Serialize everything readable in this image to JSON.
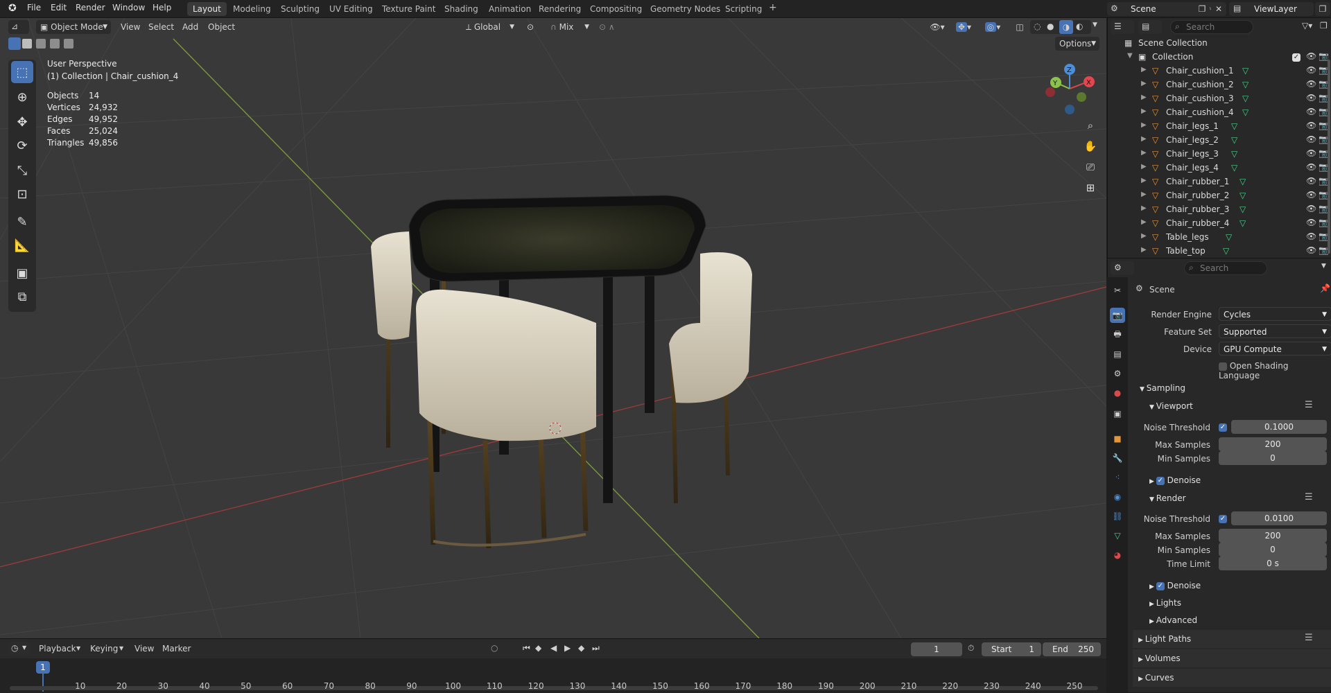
{
  "app_menu": [
    "File",
    "Edit",
    "Render",
    "Window",
    "Help"
  ],
  "workspaces": [
    "Layout",
    "Modeling",
    "Sculpting",
    "UV Editing",
    "Texture Paint",
    "Shading",
    "Animation",
    "Rendering",
    "Compositing",
    "Geometry Nodes",
    "Scripting"
  ],
  "active_workspace": "Layout",
  "add_workspace_icon": "plus-icon",
  "scene_name": "Scene",
  "view_layer": "ViewLayer",
  "viewport_header": {
    "mode": "Object Mode",
    "menus": [
      "View",
      "Select",
      "Add",
      "Object"
    ],
    "transform_orientation": "Global",
    "snap_mode": "Mix",
    "options_label": "Options"
  },
  "overlay_text": {
    "view_name": "User Perspective",
    "collection_object": "(1) Collection | Chair_cushion_4",
    "stats": [
      {
        "label": "Objects",
        "value": "14"
      },
      {
        "label": "Vertices",
        "value": "24,932"
      },
      {
        "label": "Edges",
        "value": "49,952"
      },
      {
        "label": "Faces",
        "value": "25,024"
      },
      {
        "label": "Triangles",
        "value": "49,856"
      }
    ]
  },
  "gizmo_axes": [
    "X",
    "Y",
    "Z"
  ],
  "tools": [
    "select-box-icon",
    "cursor-icon",
    "move-icon",
    "rotate-icon",
    "scale-icon",
    "transform-icon",
    "annotate-icon",
    "measure-icon",
    "add-cube-icon",
    "extrude-icon"
  ],
  "timeline": {
    "menus": [
      "Playback",
      "Keying",
      "View",
      "Marker"
    ],
    "current_frame": "1",
    "start_label": "Start",
    "start": "1",
    "end_label": "End",
    "end": "250",
    "ticks": [
      "1",
      "10",
      "20",
      "30",
      "40",
      "50",
      "60",
      "70",
      "80",
      "90",
      "100",
      "110",
      "120",
      "130",
      "140",
      "150",
      "160",
      "170",
      "180",
      "190",
      "200",
      "210",
      "220",
      "230",
      "240",
      "250"
    ]
  },
  "outliner": {
    "search_placeholder": "Search",
    "root": "Scene Collection",
    "collection": "Collection",
    "items": [
      "Chair_cushion_1",
      "Chair_cushion_2",
      "Chair_cushion_3",
      "Chair_cushion_4",
      "Chair_legs_1",
      "Chair_legs_2",
      "Chair_legs_3",
      "Chair_legs_4",
      "Chair_rubber_1",
      "Chair_rubber_2",
      "Chair_rubber_3",
      "Chair_rubber_4",
      "Table_legs",
      "Table_top"
    ],
    "selected": "Chair_cushion_4"
  },
  "properties": {
    "search_placeholder": "Search",
    "context": "Scene",
    "render_engine_label": "Render Engine",
    "render_engine": "Cycles",
    "feature_set_label": "Feature Set",
    "feature_set": "Supported",
    "device_label": "Device",
    "device": "GPU Compute",
    "osl_label": "Open Shading Language",
    "sampling_label": "Sampling",
    "viewport_label": "Viewport",
    "render_label": "Render",
    "noise_threshold_label": "Noise Threshold",
    "max_samples_label": "Max Samples",
    "min_samples_label": "Min Samples",
    "time_limit_label": "Time Limit",
    "denoise_label": "Denoise",
    "viewport_noise_threshold": "0.1000",
    "viewport_max_samples": "200",
    "viewport_min_samples": "0",
    "render_noise_threshold": "0.0100",
    "render_max_samples": "200",
    "render_min_samples": "0",
    "render_time_limit": "0 s",
    "lights_label": "Lights",
    "advanced_label": "Advanced",
    "light_paths_label": "Light Paths",
    "volumes_label": "Volumes",
    "curves_label": "Curves"
  },
  "colors": {
    "accent": "#4772b3",
    "x_axis": "#e0474e",
    "y_axis": "#8bc34a",
    "z_axis": "#4c8fd6",
    "object_orange": "#e59539",
    "mesh_green": "#4ad18a"
  }
}
